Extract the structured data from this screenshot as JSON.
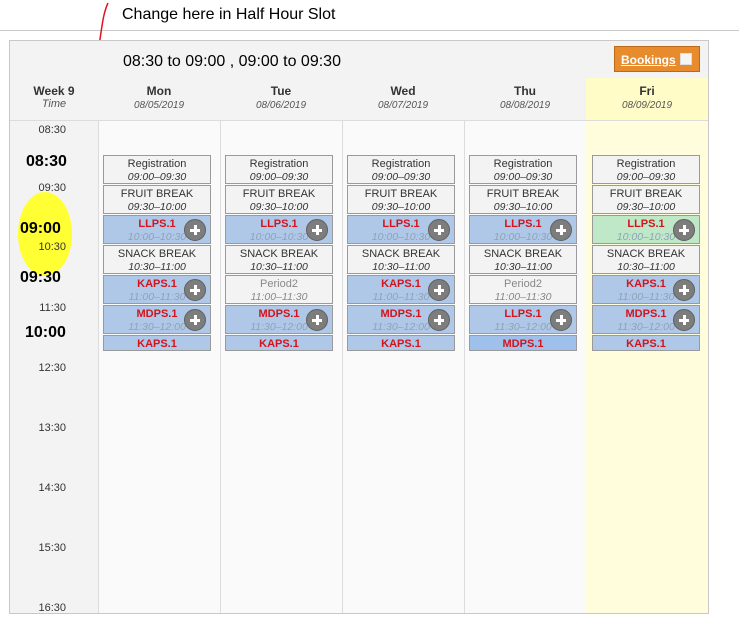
{
  "annotation": {
    "text": "Change here in Half Hour Slot"
  },
  "header": {
    "range_title": "08:30 to 09:00 , 09:00 to 09:30",
    "bookings_label": "Bookings"
  },
  "time_column": {
    "week": "Week 9",
    "time_label": "Time",
    "ticks": [
      "08:30",
      "09:30",
      "10:30",
      "11:30",
      "12:30",
      "13:30",
      "14:30",
      "15:30",
      "16:30"
    ],
    "big_times": [
      "08:30",
      "09:00",
      "09:30",
      "10:00"
    ]
  },
  "days": [
    {
      "name": "Mon",
      "date": "08/05/2019",
      "slots": [
        {
          "title": "Registration",
          "time": "09:00–09:30"
        },
        {
          "title": "FRUIT BREAK",
          "time": "09:30–10:00"
        },
        {
          "title": "LLPS.1",
          "time": "10:00–10:30"
        },
        {
          "title": "SNACK BREAK",
          "time": "10:30–11:00"
        },
        {
          "title": "KAPS.1",
          "time": "11:00–11:30"
        },
        {
          "title": "MDPS.1",
          "time": "11:30–12:00"
        },
        {
          "title": "KAPS.1",
          "time": ""
        }
      ]
    },
    {
      "name": "Tue",
      "date": "08/06/2019",
      "slots": [
        {
          "title": "Registration",
          "time": "09:00–09:30"
        },
        {
          "title": "FRUIT BREAK",
          "time": "09:30–10:00"
        },
        {
          "title": "LLPS.1",
          "time": "10:00–10:30"
        },
        {
          "title": "SNACK BREAK",
          "time": "10:30–11:00"
        },
        {
          "title": "Period2",
          "time": "11:00–11:30"
        },
        {
          "title": "MDPS.1",
          "time": "11:30–12:00"
        },
        {
          "title": "KAPS.1",
          "time": ""
        }
      ]
    },
    {
      "name": "Wed",
      "date": "08/07/2019",
      "slots": [
        {
          "title": "Registration",
          "time": "09:00–09:30"
        },
        {
          "title": "FRUIT BREAK",
          "time": "09:30–10:00"
        },
        {
          "title": "LLPS.1",
          "time": "10:00–10:30"
        },
        {
          "title": "SNACK BREAK",
          "time": "10:30–11:00"
        },
        {
          "title": "KAPS.1",
          "time": "11:00–11:30"
        },
        {
          "title": "MDPS.1",
          "time": "11:30–12:00"
        },
        {
          "title": "KAPS.1",
          "time": ""
        }
      ]
    },
    {
      "name": "Thu",
      "date": "08/08/2019",
      "slots": [
        {
          "title": "Registration",
          "time": "09:00–09:30"
        },
        {
          "title": "FRUIT BREAK",
          "time": "09:30–10:00"
        },
        {
          "title": "LLPS.1",
          "time": "10:00–10:30"
        },
        {
          "title": "SNACK BREAK",
          "time": "10:30–11:00"
        },
        {
          "title": "Period2",
          "time": "11:00–11:30"
        },
        {
          "title": "LLPS.1",
          "time": "11:30–12:00"
        },
        {
          "title": "MDPS.1",
          "time": ""
        }
      ]
    },
    {
      "name": "Fri",
      "date": "08/09/2019",
      "slots": [
        {
          "title": "Registration",
          "time": "09:00–09:30"
        },
        {
          "title": "FRUIT BREAK",
          "time": "09:30–10:00"
        },
        {
          "title": "LLPS.1",
          "time": "10:00–10:30"
        },
        {
          "title": "SNACK BREAK",
          "time": "10:30–11:00"
        },
        {
          "title": "KAPS.1",
          "time": "11:00–11:30"
        },
        {
          "title": "MDPS.1",
          "time": "11:30–12:00"
        },
        {
          "title": "KAPS.1",
          "time": ""
        }
      ]
    }
  ],
  "colors": {
    "bookings": "#e88b2d",
    "highlight": "#ffff33",
    "annotation_line": "#e0141e",
    "friday": "#fffddb"
  }
}
